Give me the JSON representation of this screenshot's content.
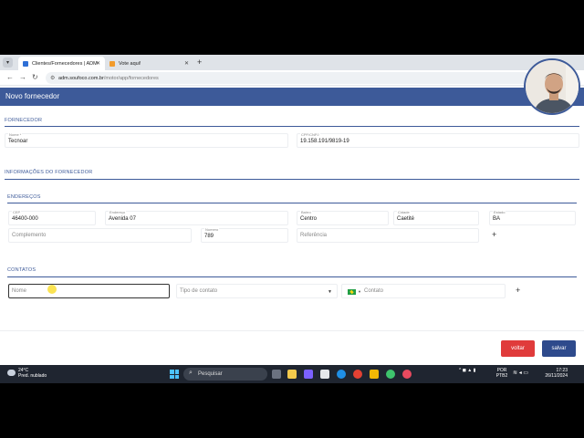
{
  "browser": {
    "tabs": [
      {
        "label": "Clientes/Fornecedores | ADM",
        "active": true,
        "color": "#2f6fd6"
      },
      {
        "label": "Vote aqui!",
        "active": false,
        "color": "#f29b2c"
      }
    ],
    "url_host": "adm.soufoco.com.br",
    "url_path": "/motor/app/fornecedores"
  },
  "app": {
    "title": "Novo fornecedor",
    "accent": "#3d5a99"
  },
  "sections": {
    "fornecedor": "FORNECEDOR",
    "informacoes": "INFORMAÇÕES DO FORNECEDOR",
    "enderecos": "ENDEREÇOS",
    "contatos": "CONTATOS"
  },
  "fornecedor": {
    "nome_label": "Nome *",
    "nome_value": "Tecnoar",
    "cpf_label": "CPF/CNPJ",
    "cpf_value": "19.158.191/9819-19"
  },
  "endereco": {
    "cep_label": "CEP",
    "cep_value": "46400-000",
    "endereco_label": "Endereço",
    "endereco_value": "Avenida 07",
    "bairro_label": "Bairro",
    "bairro_value": "Centro",
    "cidade_label": "Cidade",
    "cidade_value": "Caetité",
    "estado_label": "Estado",
    "estado_value": "BA",
    "complemento_placeholder": "Complemento",
    "numero_label": "Numero",
    "numero_value": "789",
    "referencia_placeholder": "Referência",
    "add": "+"
  },
  "contato": {
    "nome_placeholder": "Nome",
    "tipo_placeholder": "Tipo de contato",
    "contato_placeholder": "Contato",
    "add": "+"
  },
  "buttons": {
    "voltar": "voltar",
    "salvar": "salvar",
    "voltar_color": "#e03b3b",
    "salvar_color": "#2e4a8c"
  },
  "taskbar": {
    "temp": "24°C",
    "weather": "Pred. nublado",
    "search": "Pesquisar",
    "lang1": "POR",
    "lang2": "PTB2",
    "time": "17:23",
    "date": "26/11/2024"
  }
}
